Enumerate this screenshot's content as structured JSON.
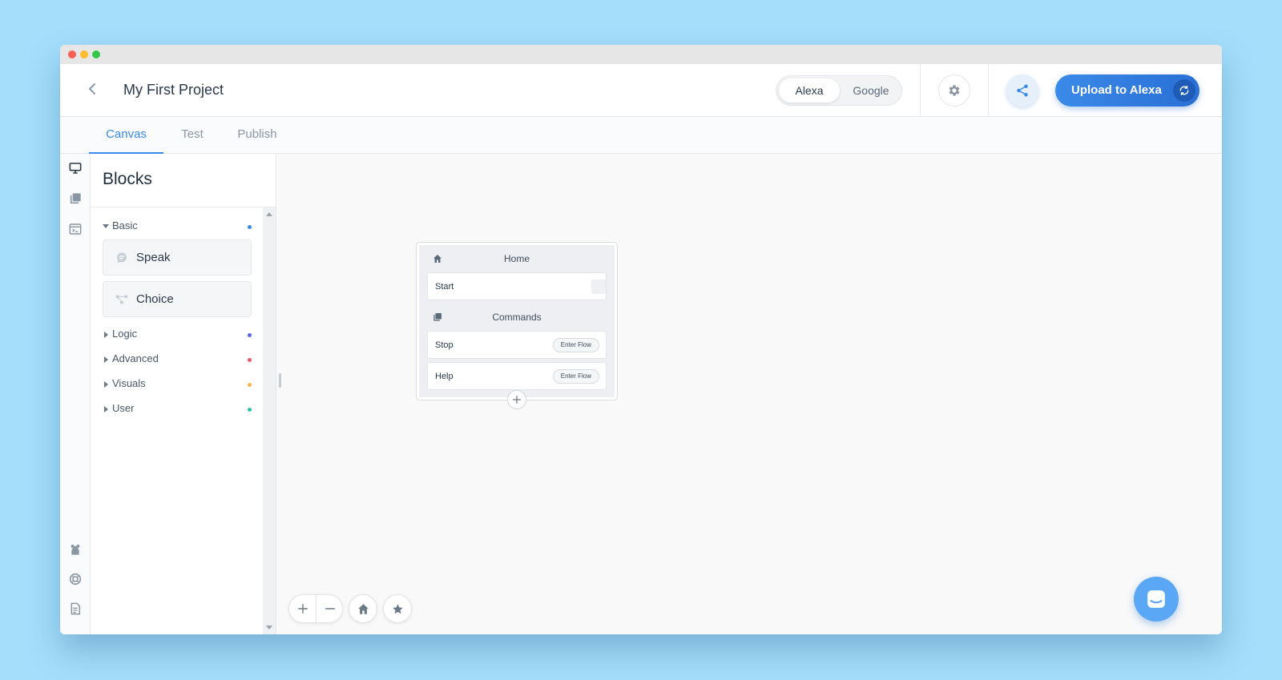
{
  "header": {
    "back_icon": "chevron-left-icon",
    "project_title": "My First Project",
    "platforms": [
      "Alexa",
      "Google"
    ],
    "selected_platform": "Alexa",
    "settings_icon": "gear-icon",
    "share_icon": "share-icon",
    "upload_label": "Upload to Alexa",
    "upload_sync_icon": "sync-icon",
    "accent_color": "#3a8ae8"
  },
  "tabs": [
    {
      "label": "Canvas",
      "active": true
    },
    {
      "label": "Test",
      "active": false
    },
    {
      "label": "Publish",
      "active": false
    }
  ],
  "rail": {
    "top_icons": [
      "monitor-icon",
      "library-icon",
      "code-window-icon"
    ],
    "bottom_icons": [
      "team-icon",
      "help-ring-icon",
      "document-icon"
    ]
  },
  "blocks_panel": {
    "title": "Blocks",
    "categories": [
      {
        "label": "Basic",
        "expanded": true,
        "dot_color": "#3a8ae8"
      },
      {
        "label": "Logic",
        "expanded": false,
        "dot_color": "#5b63e6"
      },
      {
        "label": "Advanced",
        "expanded": false,
        "dot_color": "#f0566b"
      },
      {
        "label": "Visuals",
        "expanded": false,
        "dot_color": "#f5b54a"
      },
      {
        "label": "User",
        "expanded": false,
        "dot_color": "#2bc4a4"
      }
    ],
    "basic_blocks": [
      {
        "label": "Speak",
        "icon": "speech-bubble-icon"
      },
      {
        "label": "Choice",
        "icon": "choice-branch-icon"
      }
    ]
  },
  "flow_card": {
    "home_label": "Home",
    "home_icon": "home-icon",
    "start_label": "Start",
    "commands_label": "Commands",
    "commands_icon": "commands-icon",
    "commands": [
      {
        "label": "Stop",
        "action": "Enter Flow"
      },
      {
        "label": "Help",
        "action": "Enter Flow"
      }
    ],
    "add_icon": "plus-icon"
  },
  "canvas_controls": {
    "zoom_in_icon": "plus-icon",
    "zoom_out_icon": "minus-icon",
    "home_icon": "home-icon",
    "star_icon": "star-icon",
    "chat_icon": "chat-icon"
  }
}
